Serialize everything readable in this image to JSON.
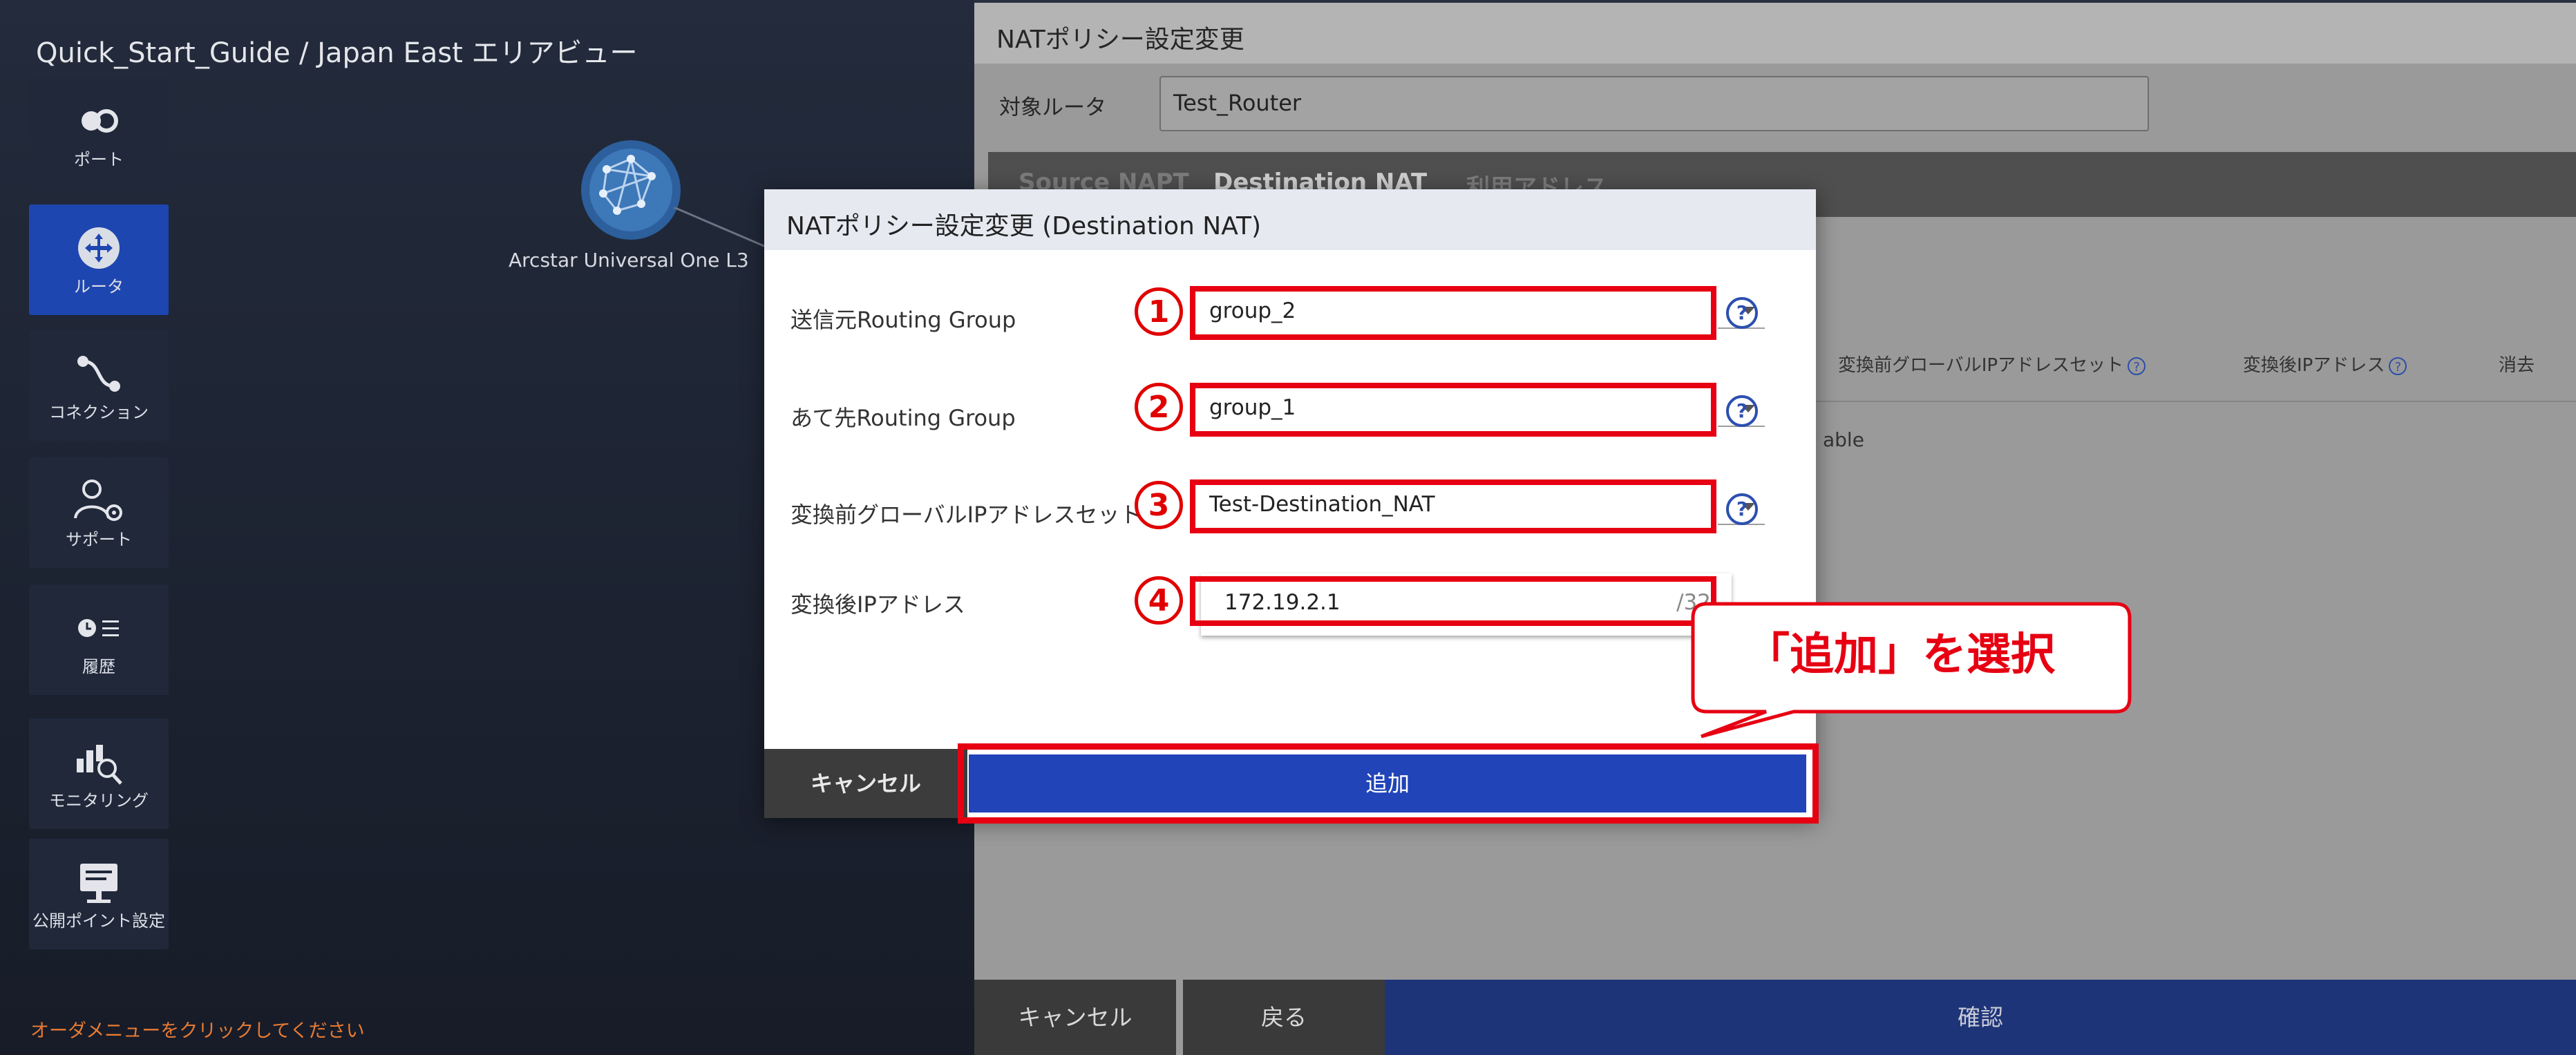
{
  "area_view": {
    "title": "Quick_Start_Guide / Japan East エリアビュー",
    "nav": [
      {
        "label": "ポート",
        "icon": "port-icon",
        "active": false
      },
      {
        "label": "ルータ",
        "icon": "router-icon",
        "active": true
      },
      {
        "label": "コネクション",
        "icon": "connection-icon",
        "active": false
      },
      {
        "label": "サポート",
        "icon": "support-icon",
        "active": false
      },
      {
        "label": "履歴",
        "icon": "history-icon",
        "active": false
      },
      {
        "label": "モニタリング",
        "icon": "monitoring-icon",
        "active": false
      },
      {
        "label": "公開ポイント設定",
        "icon": "public-point-icon",
        "active": false
      }
    ],
    "node_label": "Arcstar Universal One L3",
    "order_hint": "オーダメニューをクリックしてください"
  },
  "nat_panel": {
    "title": "NATポリシー設定変更",
    "router_label": "対象ルータ",
    "router_value": "Test_Router",
    "tabs": [
      "Source NAPT",
      "Destination NAT",
      "利用アドレス"
    ],
    "selected_tab": "Destination NAT",
    "columns": [
      "変換前グローバルIPアドレスセット",
      "変換後IPアドレス",
      "消去"
    ],
    "empty_text": "able",
    "footer": {
      "cancel": "キャンセル",
      "back": "戻る",
      "confirm": "確認"
    }
  },
  "modal": {
    "title": "NATポリシー設定変更 (Destination NAT)",
    "fields": [
      {
        "badge": "1",
        "label": "送信元Routing Group",
        "value": "group_2"
      },
      {
        "badge": "2",
        "label": "あて先Routing Group",
        "value": "group_1"
      },
      {
        "badge": "3",
        "label": "変換前グローバルIPアドレスセット",
        "value": "Test-Destination_NAT"
      }
    ],
    "ip_field": {
      "badge": "4",
      "label": "変換後IPアドレス",
      "value": "172.19.2.1",
      "suffix": "/32"
    },
    "cancel": "キャンセル",
    "add": "追加"
  },
  "callout": {
    "text": "「追加」を選択"
  },
  "colors": {
    "accent_blue": "#2144b8",
    "highlight_red": "#e60012",
    "active_nav": "#1e46b0",
    "hint_orange": "#e87a33"
  }
}
